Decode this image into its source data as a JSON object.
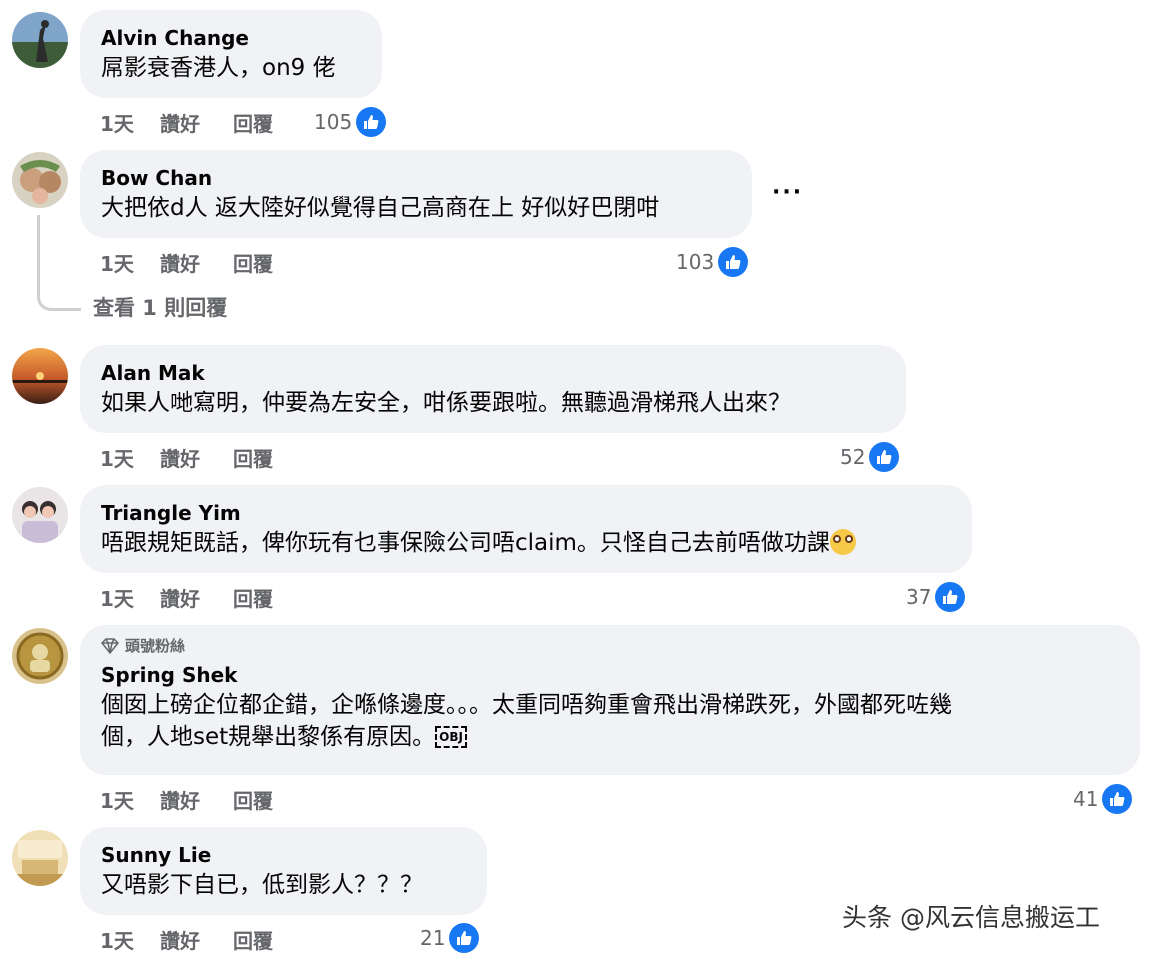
{
  "comments": [
    {
      "name": "Alvin Change",
      "text": "屌影衰香港人，on9 佬",
      "time": "1天",
      "like": "讚好",
      "reply": "回覆",
      "count": "105"
    },
    {
      "name": "Bow Chan",
      "text": "大把依d人 返大陸好似覺得自己高商在上 好似好巴閉咁",
      "time": "1天",
      "like": "讚好",
      "reply": "回覆",
      "count": "103",
      "more": "···",
      "view_replies": "查看 1 則回覆"
    },
    {
      "name": "Alan Mak",
      "text": "如果人哋寫明，仲要為左安全，咁係要跟啦。無聽過滑梯飛人出來？",
      "time": "1天",
      "like": "讚好",
      "reply": "回覆",
      "count": "52"
    },
    {
      "name": "Triangle Yim",
      "text": "唔跟規矩既話，俾你玩有乜事保險公司唔claim。只怪自己去前唔做功課",
      "emoji": "dizzy-face",
      "time": "1天",
      "like": "讚好",
      "reply": "回覆",
      "count": "37"
    },
    {
      "badge": "頭號粉絲",
      "name": "Spring Shek",
      "text_line1": "個囡上磅企位都企錯，企喺條邊度。。。太重同唔夠重會飛出滑梯跌死，外國都死咗幾",
      "text_line2": "個，人地set規舉出黎係有原因。",
      "obj_glyph": "OBJ",
      "time": "1天",
      "like": "讚好",
      "reply": "回覆",
      "count": "41"
    },
    {
      "name": "Sunny Lie",
      "text": "又唔影下自已，低到影人？？？",
      "time": "1天",
      "like": "讚好",
      "reply": "回覆",
      "count": "21"
    }
  ],
  "watermark": "头条 @风云信息搬运工",
  "colors": {
    "bubble": "#f0f2f5",
    "like_blue": "#1877f2",
    "meta_gray": "#65676b"
  }
}
